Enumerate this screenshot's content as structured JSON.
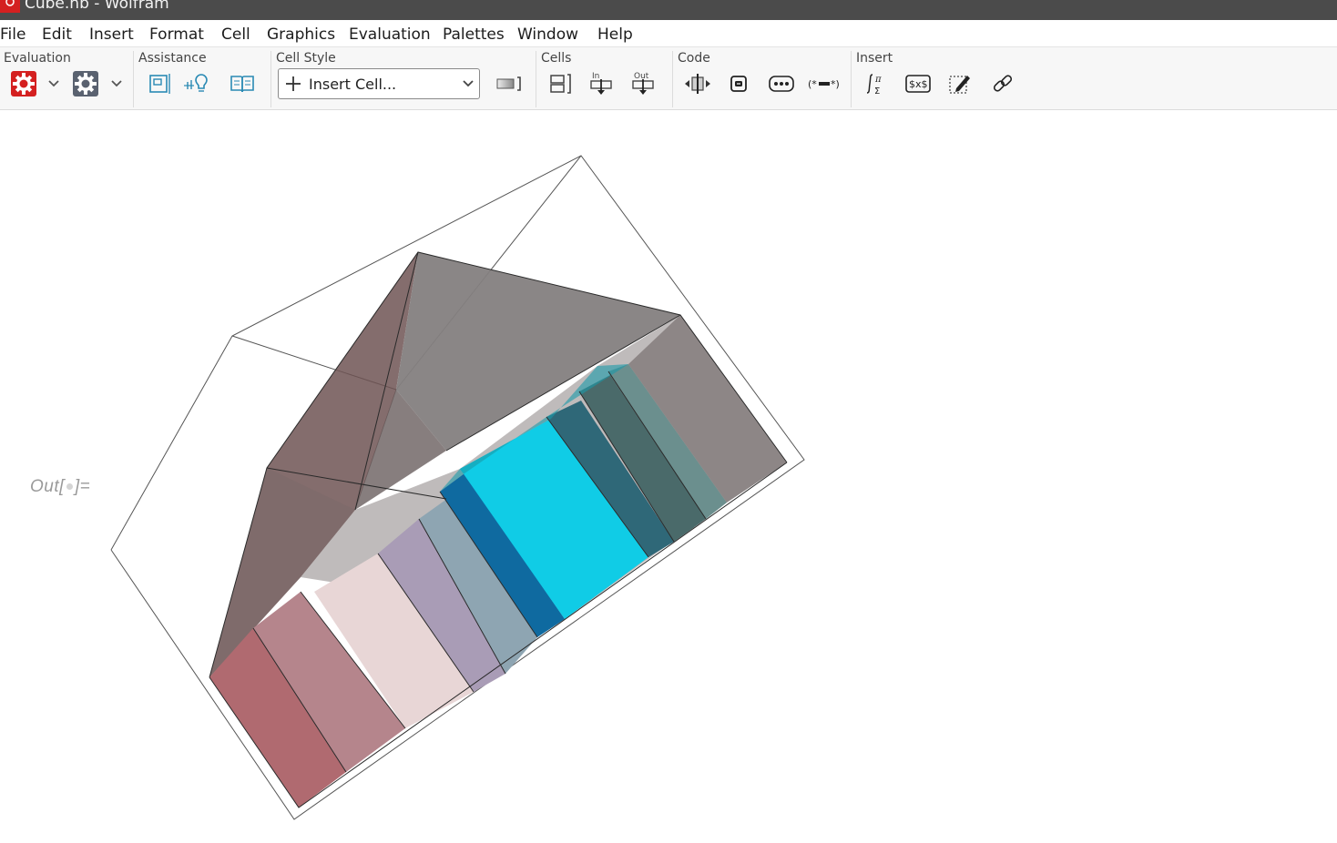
{
  "window": {
    "title": "Cube.nb - Wolfram"
  },
  "menu": [
    "File",
    "Edit",
    "Insert",
    "Format",
    "Cell",
    "Graphics",
    "Evaluation",
    "Palettes",
    "Window",
    "Help"
  ],
  "toolbar": {
    "groups": {
      "evaluation": "Evaluation",
      "assistance": "Assistance",
      "cell_style": "Cell Style",
      "cells": "Cells",
      "code": "Code",
      "insert": "Insert"
    },
    "cell_style_value": "Insert Cell...",
    "cells_in_label": "In",
    "cells_out_label": "Out",
    "accent_color": "#d42020"
  },
  "output": {
    "label_prefix": "Out[",
    "label_suffix": "]="
  },
  "graphic": {
    "type": "3D bar plot",
    "bar_colors": [
      "#b06a70",
      "#b5858c",
      "#e8d6d6",
      "#a99cb6",
      "#8ea5b2",
      "#0f6aa0",
      "#10cce6",
      "#2f6878",
      "#4a6a6a",
      "#6b8f8e"
    ]
  }
}
